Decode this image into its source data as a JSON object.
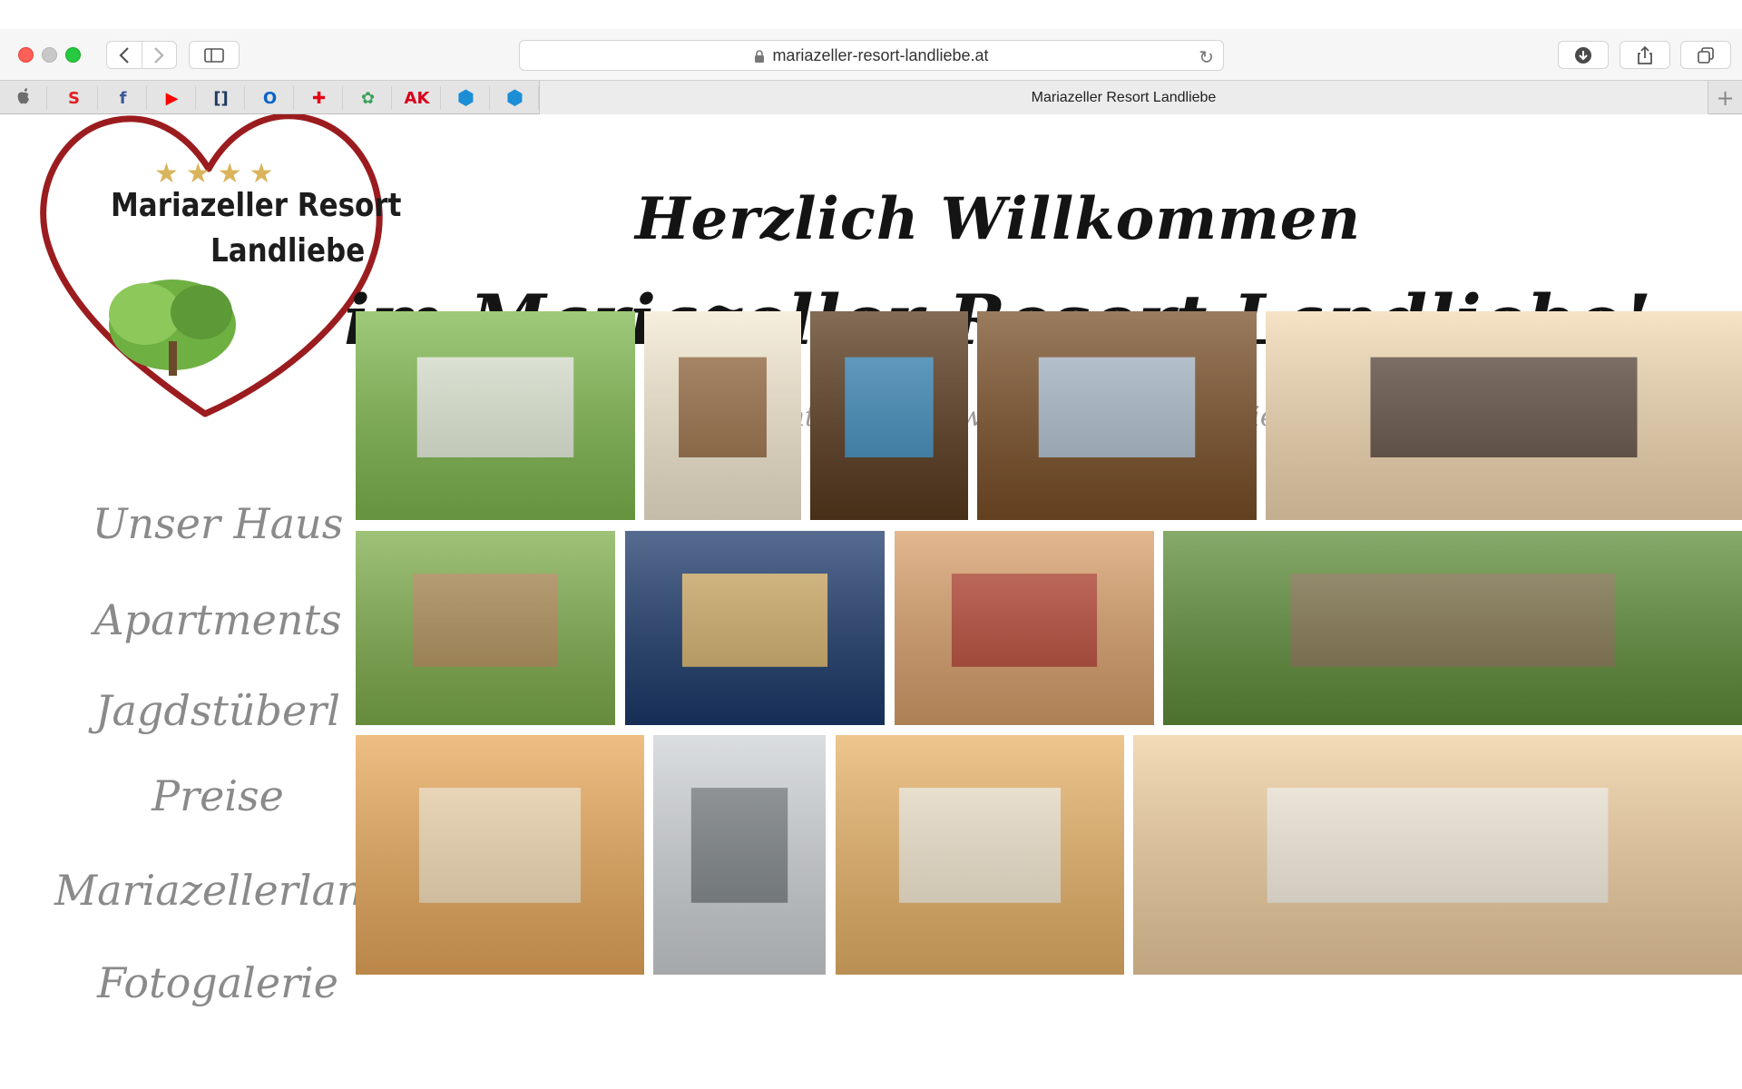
{
  "browser": {
    "url": "mariazeller-resort-landliebe.at",
    "tab_title": "Mariazeller Resort Landliebe",
    "new_tab_label": "+",
    "favorites": [
      {
        "name": "apple-icon",
        "color": "#6d6d6d"
      },
      {
        "name": "s-icon",
        "color": "#e31e24"
      },
      {
        "name": "facebook-icon",
        "color": "#3b5998"
      },
      {
        "name": "youtube-icon",
        "color": "#ff0000"
      },
      {
        "name": "bracket-icon",
        "color": "#1e3a5f"
      },
      {
        "name": "outlook-icon",
        "color": "#0a64c8"
      },
      {
        "name": "red-cross-icon",
        "color": "#e30613"
      },
      {
        "name": "clover-icon",
        "color": "#3aa35a"
      },
      {
        "name": "ak-icon",
        "color": "#d6001c"
      },
      {
        "name": "hexagon-icon",
        "color": "#1c8ed6"
      },
      {
        "name": "hexagon-icon",
        "color": "#1c8ed6"
      }
    ]
  },
  "logo": {
    "stars": "★★★★",
    "line1": "Mariazeller Resort",
    "line2": "Landliebe"
  },
  "hero": {
    "line1": "Herzlich Willkommen",
    "line2": "im Mariazeller Resort Landliebe!",
    "subtitle": "Apartments & Ferienwohnungen zum Genießen"
  },
  "menu": [
    {
      "label": "Unser Haus"
    },
    {
      "label": "Apartments"
    },
    {
      "label": "Jagdstüberl"
    },
    {
      "label": "Preise"
    },
    {
      "label": "Mariazellerland"
    },
    {
      "label": "Fotogalerie"
    }
  ],
  "gallery": [
    {
      "name": "gallery-house-summer",
      "bg": "#7fb84e",
      "accent": "#f2f2ee"
    },
    {
      "name": "gallery-entrance-door",
      "bg": "#f5ead2",
      "accent": "#8a5a2f"
    },
    {
      "name": "gallery-library-bar",
      "bg": "#5a3a1e",
      "accent": "#3a9ad6"
    },
    {
      "name": "gallery-wine-cooler",
      "bg": "#7a5028",
      "accent": "#b7d0e8"
    },
    {
      "name": "gallery-living-room",
      "bg": "#f3d9b3",
      "accent": "#4a3a32"
    },
    {
      "name": "gallery-wooden-shed",
      "bg": "#7fae4c",
      "accent": "#b88a5a"
    },
    {
      "name": "gallery-house-winter",
      "bg": "#1d3a6b",
      "accent": "#f2c46a"
    },
    {
      "name": "gallery-sofa-lounge",
      "bg": "#d9a06b",
      "accent": "#b03a2e"
    },
    {
      "name": "gallery-garden-terrace",
      "bg": "#5f8e3a",
      "accent": "#8b7355"
    },
    {
      "name": "gallery-room-wood",
      "bg": "#e8a95b",
      "accent": "#f4e3c4"
    },
    {
      "name": "gallery-bathroom",
      "bg": "#cfd3d6",
      "accent": "#6f7478"
    },
    {
      "name": "gallery-bedroom",
      "bg": "#e8b368",
      "accent": "#f5efe2"
    },
    {
      "name": "gallery-kitchen",
      "bg": "#f0cfa0",
      "accent": "#f7f2ea"
    }
  ]
}
